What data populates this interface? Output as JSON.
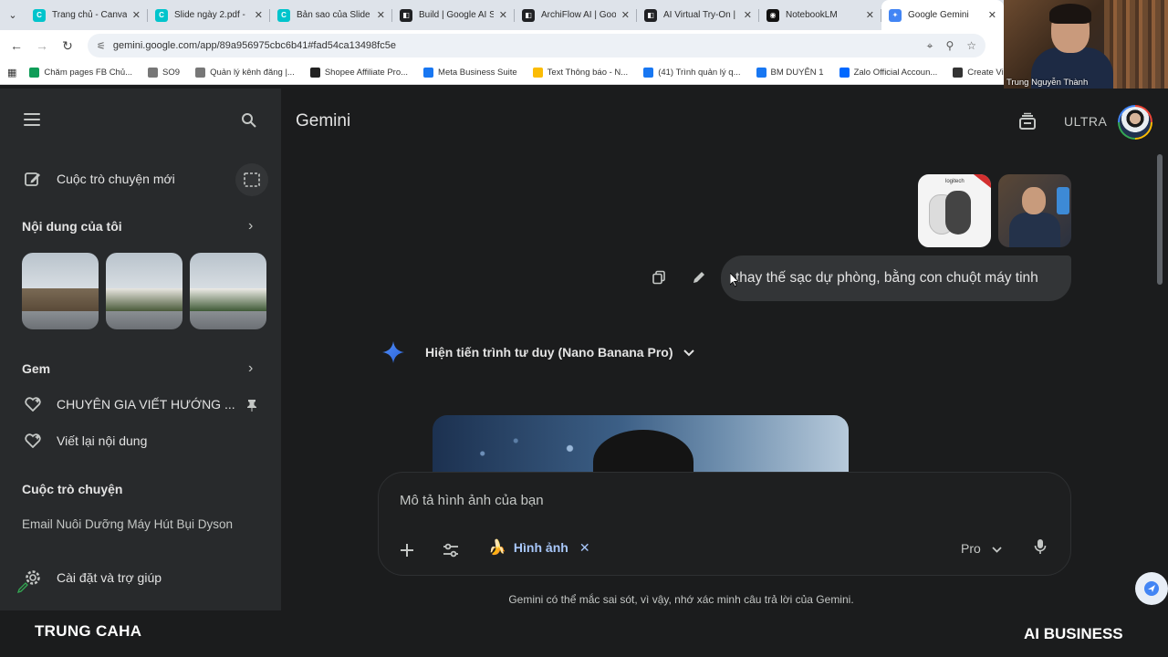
{
  "browser": {
    "tabs": [
      {
        "title": "Trang chủ - Canva",
        "color": "#00c4cc",
        "glyph": "C"
      },
      {
        "title": "Slide ngày 2.pdf - ",
        "color": "#00c4cc",
        "glyph": "C"
      },
      {
        "title": "Bản sao của Slide",
        "color": "#00c4cc",
        "glyph": "C"
      },
      {
        "title": "Build | Google AI S",
        "color": "#202124",
        "glyph": "◧"
      },
      {
        "title": "ArchiFlow AI | Goo",
        "color": "#202124",
        "glyph": "◧"
      },
      {
        "title": "AI Virtual Try-On |",
        "color": "#202124",
        "glyph": "◧"
      },
      {
        "title": "NotebookLM",
        "color": "#111111",
        "glyph": "◉"
      },
      {
        "title": "Google Gemini",
        "color": "#4285f4",
        "glyph": "✦",
        "active": true
      }
    ],
    "url": "gemini.google.com/app/89a956975cbc6b41#fad54ca13498fc5e",
    "bookmarks": [
      {
        "label": "Chăm pages FB Chủ...",
        "color": "#0f9d58"
      },
      {
        "label": "SO9",
        "color": "#777777"
      },
      {
        "label": "Quản lý kênh đăng |...",
        "color": "#777777"
      },
      {
        "label": "Shopee Affiliate Pro...",
        "color": "#222222"
      },
      {
        "label": "Meta Business Suite",
        "color": "#1877f2"
      },
      {
        "label": "Text Thông báo - N...",
        "color": "#fbbc04"
      },
      {
        "label": "(41) Trình quản lý q...",
        "color": "#1877f2"
      },
      {
        "label": "BM DUYÊN 1",
        "color": "#1877f2"
      },
      {
        "label": "Zalo Official Accoun...",
        "color": "#0068ff"
      },
      {
        "label": "Create Vide",
        "color": "#333333"
      }
    ]
  },
  "webcam": {
    "name": "Trung Nguyễn Thành"
  },
  "app": {
    "title": "Gemini",
    "plan": "ULTRA"
  },
  "sidebar": {
    "new_chat": "Cuộc trò chuyện mới",
    "my_content": "Nội dung của tôi",
    "gem_heading": "Gem",
    "gems": [
      "CHUYÊN GIA VIẾT HƯỚNG ...",
      "Viết lại nội dung"
    ],
    "chats_heading": "Cuộc trò chuyện",
    "recent_chat": "Email Nuôi Dưỡng Máy Hút Bụi Dyson",
    "settings": "Cài đặt và trợ giúp"
  },
  "conversation": {
    "user_message": "thay thế sạc dự phòng, bằng con chuột máy tinh",
    "attachment_brand": "logitech",
    "thinking_label": "Hiện tiến trình tư duy (Nano Banana Pro)"
  },
  "composer": {
    "placeholder": "Mô tả hình ảnh của bạn",
    "chip_label": "Hình ảnh",
    "model": "Pro"
  },
  "disclaimer": "Gemini có thể mắc sai sót, vì vậy, nhớ xác minh câu trả lời của Gemini.",
  "overlay": {
    "left": "TRUNG CAHA",
    "right": "AI BUSINESS"
  }
}
